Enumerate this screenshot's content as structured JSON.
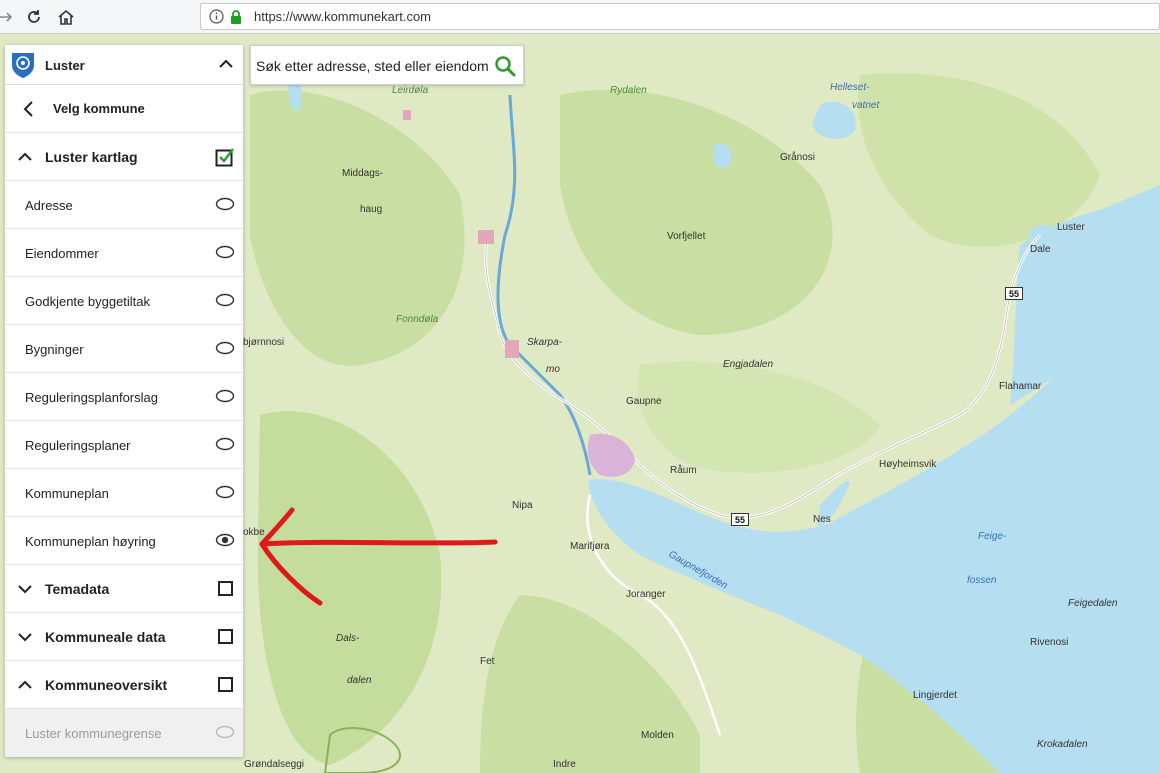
{
  "browser": {
    "url": "https://www.kommunekart.com"
  },
  "search": {
    "placeholder": "Søk etter adresse, sted eller eiendom"
  },
  "panel": {
    "municipality": "Luster",
    "back_label": "Velg kommune",
    "layer_group": "Luster kartlag",
    "layers": [
      {
        "label": "Adresse",
        "visible": false
      },
      {
        "label": "Eiendommer",
        "visible": false
      },
      {
        "label": "Godkjente byggetiltak",
        "visible": false
      },
      {
        "label": "Bygninger",
        "visible": false
      },
      {
        "label": "Reguleringsplanforslag",
        "visible": false
      },
      {
        "label": "Reguleringsplaner",
        "visible": false
      },
      {
        "label": "Kommuneplan",
        "visible": false
      },
      {
        "label": "Kommuneplan høyring",
        "visible": true
      }
    ],
    "sections": [
      {
        "label": "Temadata",
        "checked": false
      },
      {
        "label": "Kommuneale data",
        "checked": false
      },
      {
        "label": "Kommuneoversikt",
        "checked": false
      }
    ],
    "disabled_layer": "Luster kommunegrense"
  },
  "map": {
    "labels": [
      "Leirdøla",
      "Rydalen",
      "Helleset-",
      "vatnet",
      "Middags-",
      "haug",
      "Grånosi",
      "Vorfjellet",
      "Luster",
      "Dale",
      "Fonndøla",
      "Skarpa-",
      "mo",
      "Engjadalen",
      "bjørnnosi",
      "Flahamar",
      "Gaupne",
      "Råum",
      "Høyheimsvik",
      "Nes",
      "Nipa",
      "Marifjøra",
      "Gaupnefjorden",
      "Feige-",
      "fossen",
      "Joranger",
      "Feigedalen",
      "Dals-",
      "dalen",
      "Fet",
      "Rivenosi",
      "Lingjerdet",
      "Molden",
      "Krokadalen",
      "Grøndalseggi",
      "Indre",
      "okbe"
    ],
    "road_number": "55"
  },
  "colors": {
    "land": "#dfe9c4",
    "forest": "#c9dea2",
    "water": "#b5dff0",
    "annotation": "#e01818"
  }
}
